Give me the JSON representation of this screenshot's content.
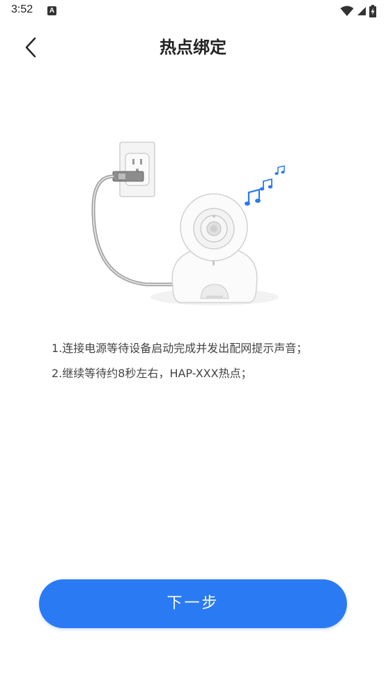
{
  "status_bar": {
    "time": "3:52",
    "notification_icon_letter": "A",
    "icons": [
      "wifi-icon",
      "signal-icon",
      "battery-charging-icon"
    ]
  },
  "header": {
    "title": "热点绑定",
    "back_icon": "chevron-left-icon"
  },
  "illustration": {
    "description_icons": [
      "power-outlet-icon",
      "camera-icon",
      "music-notes-icon"
    ],
    "accent_color": "#2a7af3"
  },
  "instructions": [
    "1.连接电源等待设备启动完成并发出配网提示声音；",
    "2.继续等待约8秒左右，HAP-XXX热点；"
  ],
  "footer": {
    "next_label": "下一步",
    "button_color": "#2a7af3"
  }
}
